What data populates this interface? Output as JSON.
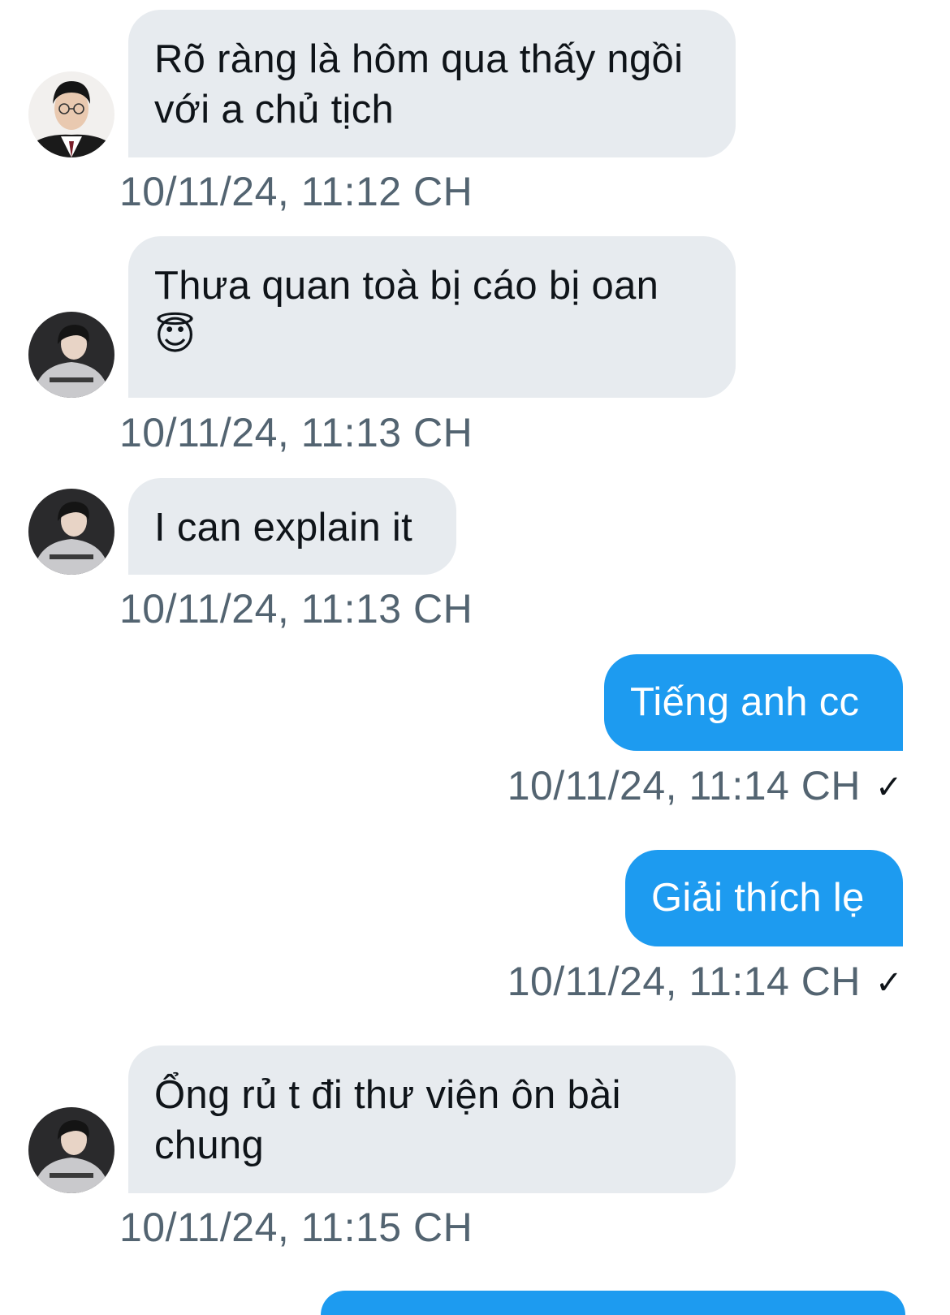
{
  "messages": [
    {
      "direction": "in",
      "text": "Rõ ràng là hôm qua thấy ngồi với a chủ tịch",
      "timestamp": "10/11/24, 11:12 CH",
      "avatar": "avatar-glasses"
    },
    {
      "direction": "in",
      "text": "Thưa quan toà bị cáo bị oan",
      "emoji": "😇",
      "timestamp": "10/11/24, 11:13 CH",
      "avatar": "avatar-hoodie"
    },
    {
      "direction": "in",
      "text": "I can explain it",
      "timestamp": "10/11/24, 11:13 CH",
      "avatar": "avatar-hoodie"
    },
    {
      "direction": "out",
      "text": "Tiếng anh cc",
      "timestamp": "10/11/24, 11:14 CH",
      "status": "✓"
    },
    {
      "direction": "out",
      "text": "Giải thích lẹ",
      "timestamp": "10/11/24, 11:14 CH",
      "status": "✓"
    },
    {
      "direction": "in",
      "text": "Ổng rủ t đi thư viện ôn bài chung",
      "timestamp": "10/11/24, 11:15 CH",
      "avatar": "avatar-hoodie"
    }
  ],
  "colors": {
    "incoming_bubble": "#e7ebef",
    "outgoing_bubble": "#1d9bf0",
    "timestamp": "#536471",
    "text_dark": "#0f1419"
  }
}
